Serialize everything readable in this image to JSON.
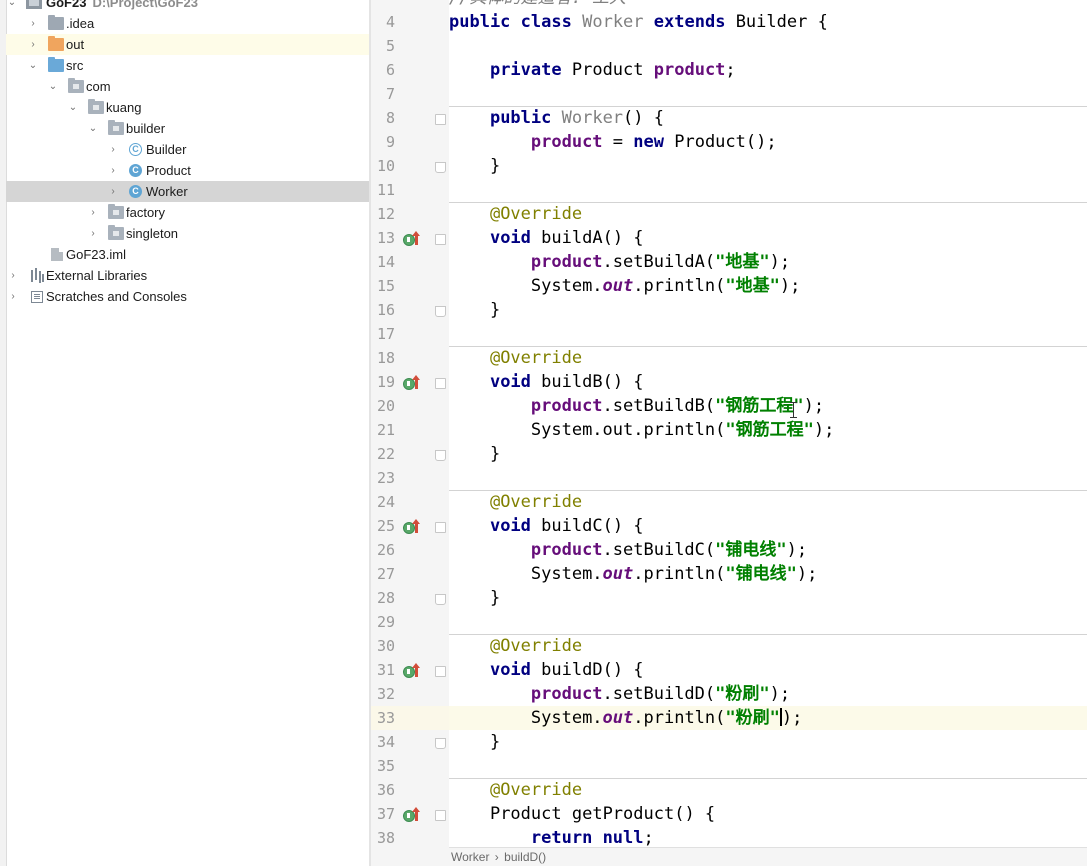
{
  "project_tree": {
    "root": {
      "label": "GoF23",
      "path": "D:\\Project\\GoF23"
    },
    "items": [
      {
        "label": ".idea"
      },
      {
        "label": "out"
      },
      {
        "label": "src"
      },
      {
        "label": "com"
      },
      {
        "label": "kuang"
      },
      {
        "label": "builder"
      },
      {
        "label": "Builder"
      },
      {
        "label": "Product"
      },
      {
        "label": "Worker"
      },
      {
        "label": "factory"
      },
      {
        "label": "singleton"
      },
      {
        "label": "GoF23.iml"
      },
      {
        "label": "External Libraries"
      },
      {
        "label": "Scratches and Consoles"
      }
    ]
  },
  "editor": {
    "file": "Worker",
    "lines": [
      {
        "n": "4"
      },
      {
        "n": "5"
      },
      {
        "n": "6"
      },
      {
        "n": "7"
      },
      {
        "n": "8"
      },
      {
        "n": "9"
      },
      {
        "n": "10"
      },
      {
        "n": "11"
      },
      {
        "n": "12"
      },
      {
        "n": "13"
      },
      {
        "n": "14"
      },
      {
        "n": "15"
      },
      {
        "n": "16"
      },
      {
        "n": "17"
      },
      {
        "n": "18"
      },
      {
        "n": "19"
      },
      {
        "n": "20"
      },
      {
        "n": "21"
      },
      {
        "n": "22"
      },
      {
        "n": "23"
      },
      {
        "n": "24"
      },
      {
        "n": "25"
      },
      {
        "n": "26"
      },
      {
        "n": "27"
      },
      {
        "n": "28"
      },
      {
        "n": "29"
      },
      {
        "n": "30"
      },
      {
        "n": "31"
      },
      {
        "n": "32"
      },
      {
        "n": "33"
      },
      {
        "n": "34"
      },
      {
        "n": "35"
      },
      {
        "n": "36"
      },
      {
        "n": "37"
      },
      {
        "n": "38"
      }
    ],
    "code": {
      "l3_comment": "//具体的建造者: 工人",
      "kw_public": "public",
      "kw_class": "class",
      "kw_extends": "extends",
      "kw_private": "private",
      "kw_void": "void",
      "kw_new": "new",
      "kw_return": "return",
      "kw_null": "null",
      "class_name": "Worker",
      "super_name": "Builder",
      "type_product": "Product",
      "field_product": "product",
      "annotation": "@Override",
      "ctor_call": "Product();",
      "buildA": "buildA",
      "buildB": "buildB",
      "buildC": "buildC",
      "buildD": "buildD",
      "getProduct": "getProduct",
      "setA": ".setBuildA(",
      "setB": ".setBuildB(",
      "setC": ".setBuildC(",
      "setD": ".setBuildD(",
      "system": "System.",
      "out": "out",
      "println": ".println(",
      "str_a": "\"地基\"",
      "str_b": "\"钢筋工程\"",
      "str_c": "\"铺电线\"",
      "str_d": "\"粉刷\""
    },
    "breadcrumb": [
      "Worker",
      "buildD()"
    ]
  }
}
